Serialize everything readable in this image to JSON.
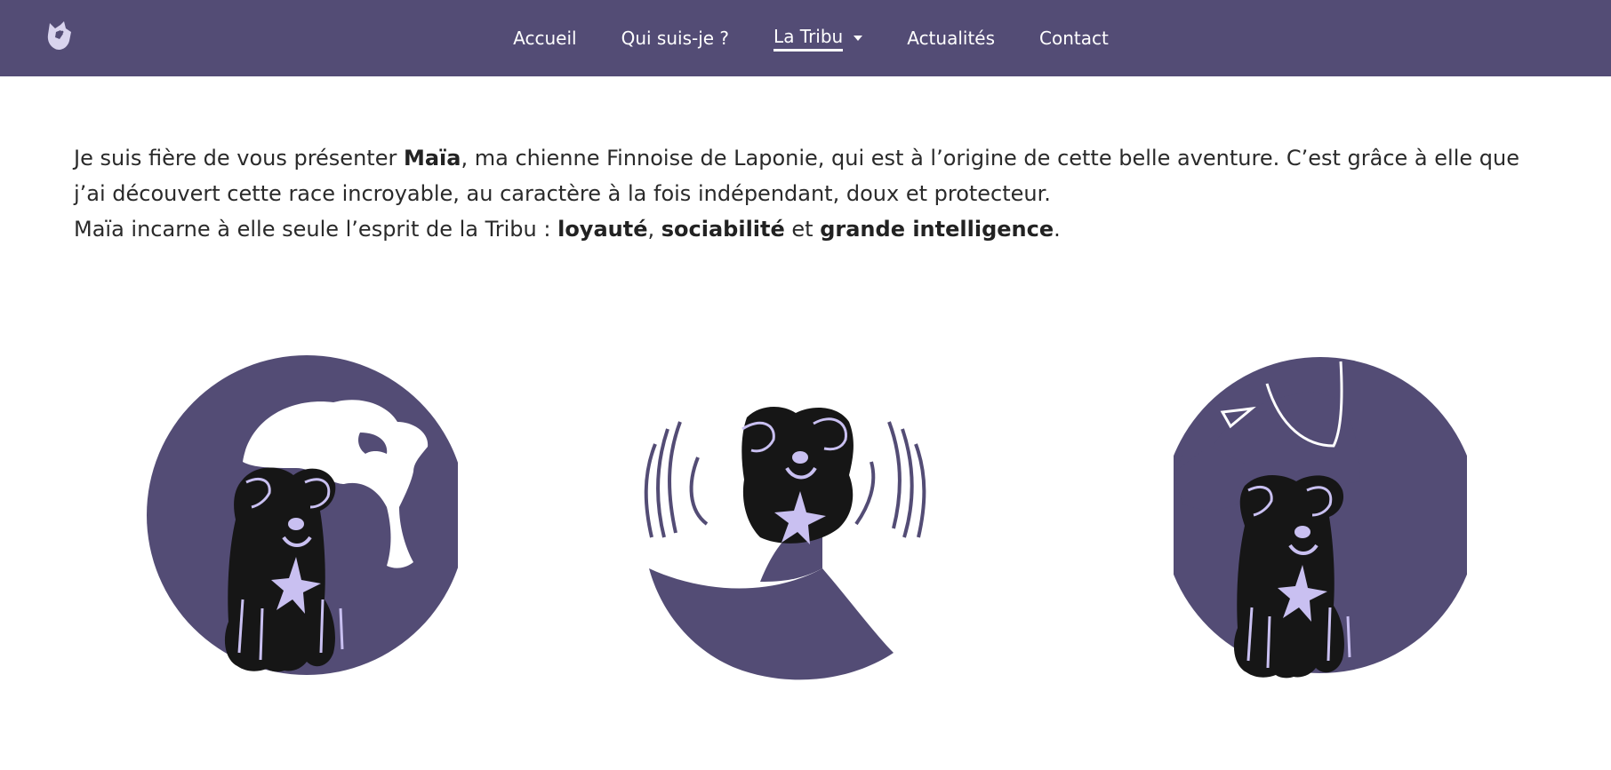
{
  "nav": {
    "items": [
      {
        "label": "Accueil"
      },
      {
        "label": "Qui suis-je ?"
      },
      {
        "label": "La Tribu"
      },
      {
        "label": "Actualités"
      },
      {
        "label": "Contact"
      }
    ],
    "active": "La Tribu",
    "logo_icon": "husky-logo-icon"
  },
  "intro": {
    "p1_a": "Je suis fière de vous présenter ",
    "p1_name": "Maïa",
    "p1_b": ", ma chienne Finnoise de Laponie, qui est à l’origine de cette belle aventure. C’est grâce à elle que j’ai découvert cette race incroyable, au caractère à la fois indépendant, doux et protecteur.",
    "p2_a": "Maïa incarne à elle seule l’esprit de la Tribu : ",
    "p2_t1": "loyauté",
    "p2_sep1": ", ",
    "p2_t2": "sociabilité",
    "p2_sep2": " et ",
    "p2_t3": "grande intelligence",
    "p2_end": "."
  },
  "colors": {
    "brand_purple": "#534c75",
    "dog_black": "#161616",
    "accent_lilac": "#c9c0f1"
  },
  "illustrations": [
    {
      "icon": "dog-with-hand-icon"
    },
    {
      "icon": "happy-dog-icon"
    },
    {
      "icon": "dog-with-protector-icon"
    }
  ]
}
